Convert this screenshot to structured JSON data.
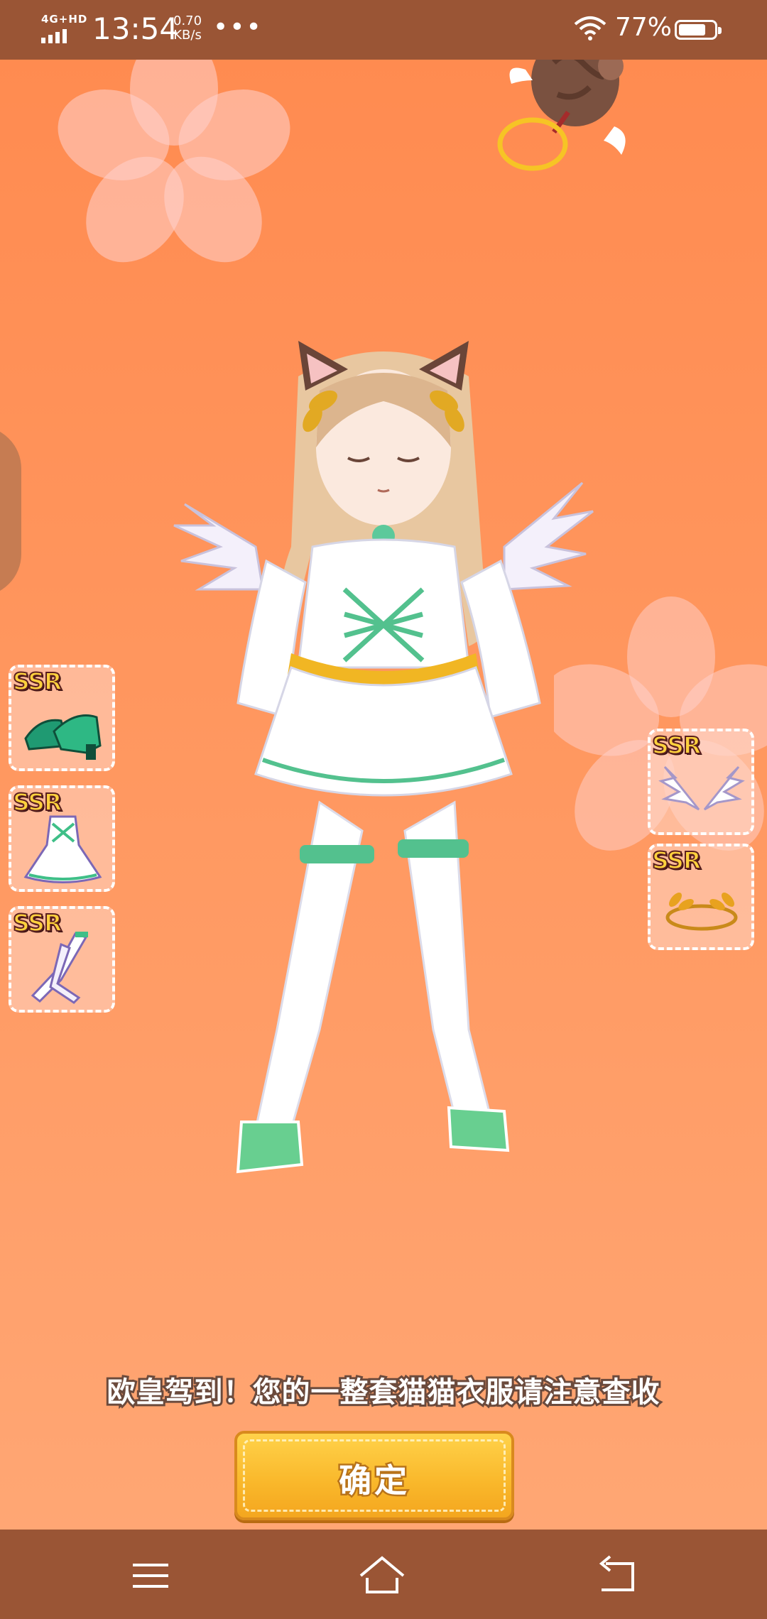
{
  "status_bar": {
    "network": "4G+HD",
    "time": "13:54",
    "speed_value": "0.70",
    "speed_unit": "KB/s",
    "more": "•••",
    "battery": "77%",
    "battery_level": 0.77
  },
  "items_left": [
    {
      "rarity": "SSR",
      "icon": "green-shoes-icon"
    },
    {
      "rarity": "SSR",
      "icon": "white-dress-icon"
    },
    {
      "rarity": "SSR",
      "icon": "white-stockings-icon"
    }
  ],
  "items_right": [
    {
      "rarity": "SSR",
      "icon": "angel-wings-icon"
    },
    {
      "rarity": "SSR",
      "icon": "laurel-crown-icon"
    }
  ],
  "notice": "欧皇驾到！您的一整套猫猫衣服请注意查收",
  "confirm_label": "确定",
  "colors": {
    "background": "#ff9660",
    "bar": "#9a5535",
    "button": "#f9b72a",
    "rarity": "#ffd23d"
  }
}
